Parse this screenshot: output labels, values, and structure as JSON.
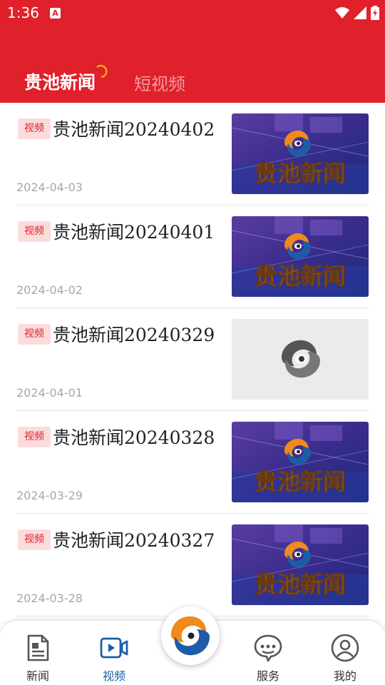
{
  "status_bar": {
    "time": "1:36",
    "notification_icon": "A"
  },
  "tabs": [
    {
      "label": "贵池新闻",
      "active": true
    },
    {
      "label": "短视频",
      "active": false
    }
  ],
  "items": [
    {
      "badge": "视频",
      "title": "贵池新闻20240402",
      "date": "2024-04-03",
      "thumbnail": "news-logo"
    },
    {
      "badge": "视频",
      "title": "贵池新闻20240401",
      "date": "2024-04-02",
      "thumbnail": "news-logo"
    },
    {
      "badge": "视频",
      "title": "贵池新闻20240329",
      "date": "2024-04-01",
      "thumbnail": "placeholder-logo"
    },
    {
      "badge": "视频",
      "title": "贵池新闻20240328",
      "date": "2024-03-29",
      "thumbnail": "news-logo"
    },
    {
      "badge": "视频",
      "title": "贵池新闻20240327",
      "date": "2024-03-28",
      "thumbnail": "news-logo"
    }
  ],
  "thumbnail_text": "贵池新闻",
  "nav": {
    "items": [
      {
        "label": "新闻",
        "icon": "document-icon",
        "active": false
      },
      {
        "label": "视频",
        "icon": "video-icon",
        "active": true
      },
      {
        "label": "服务",
        "icon": "chat-icon",
        "active": false
      },
      {
        "label": "我的",
        "icon": "user-icon",
        "active": false
      }
    ],
    "center_icon": "app-logo-icon"
  },
  "colors": {
    "brand_red": "#e0202a",
    "active_blue": "#1a5fa8",
    "logo_orange": "#f08a1c",
    "logo_blue": "#1e5ca8"
  }
}
